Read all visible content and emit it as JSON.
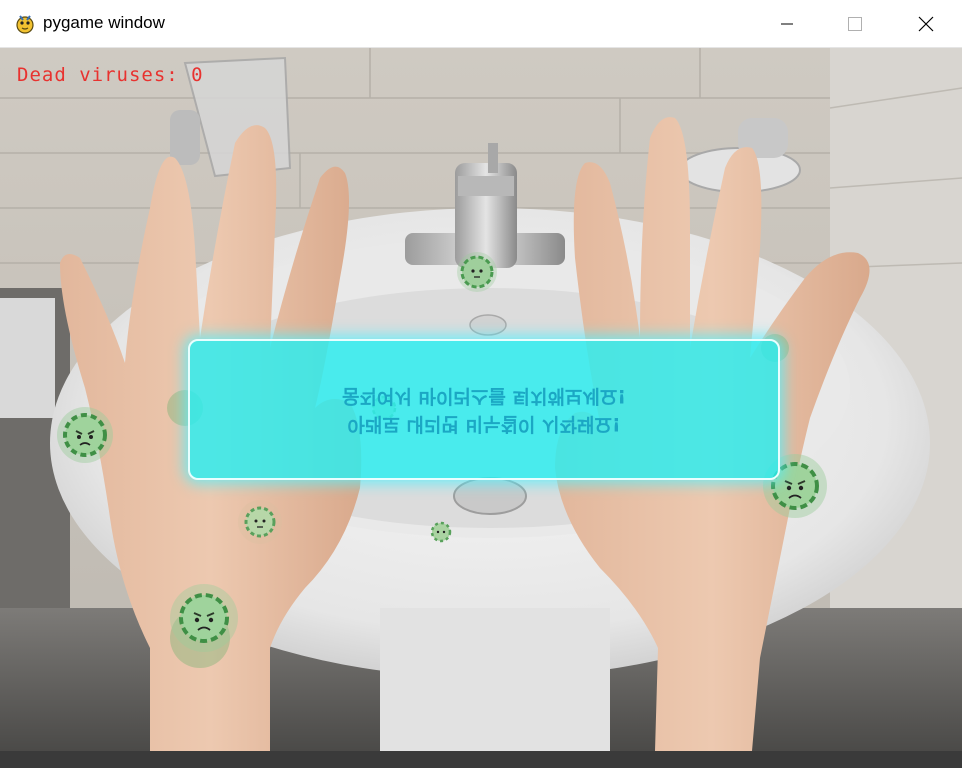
{
  "window": {
    "title": "pygame window",
    "icon": "pygame-snake-icon",
    "controls": [
      "minimize-icon",
      "maximize-icon",
      "close-icon"
    ]
  },
  "hud": {
    "score_text": "Dead viruses: 0",
    "score_color": "#e8322f"
  },
  "banner": {
    "line1": "움직여서 바이러스를 퇴치해보세요!",
    "line2": "아래로 내리면 비누칠이 시작돼요!",
    "color": "#28eef0"
  },
  "viruses": [
    {
      "name": "virus-left-hand-upper",
      "mood": "angry"
    },
    {
      "name": "virus-left-palm",
      "mood": "neutral"
    },
    {
      "name": "virus-left-wrist",
      "mood": "angry"
    },
    {
      "name": "virus-faucet",
      "mood": "neutral"
    },
    {
      "name": "virus-center-small",
      "mood": "neutral"
    },
    {
      "name": "virus-center-tiny",
      "mood": "neutral"
    },
    {
      "name": "virus-right-hand",
      "mood": "angry"
    }
  ]
}
